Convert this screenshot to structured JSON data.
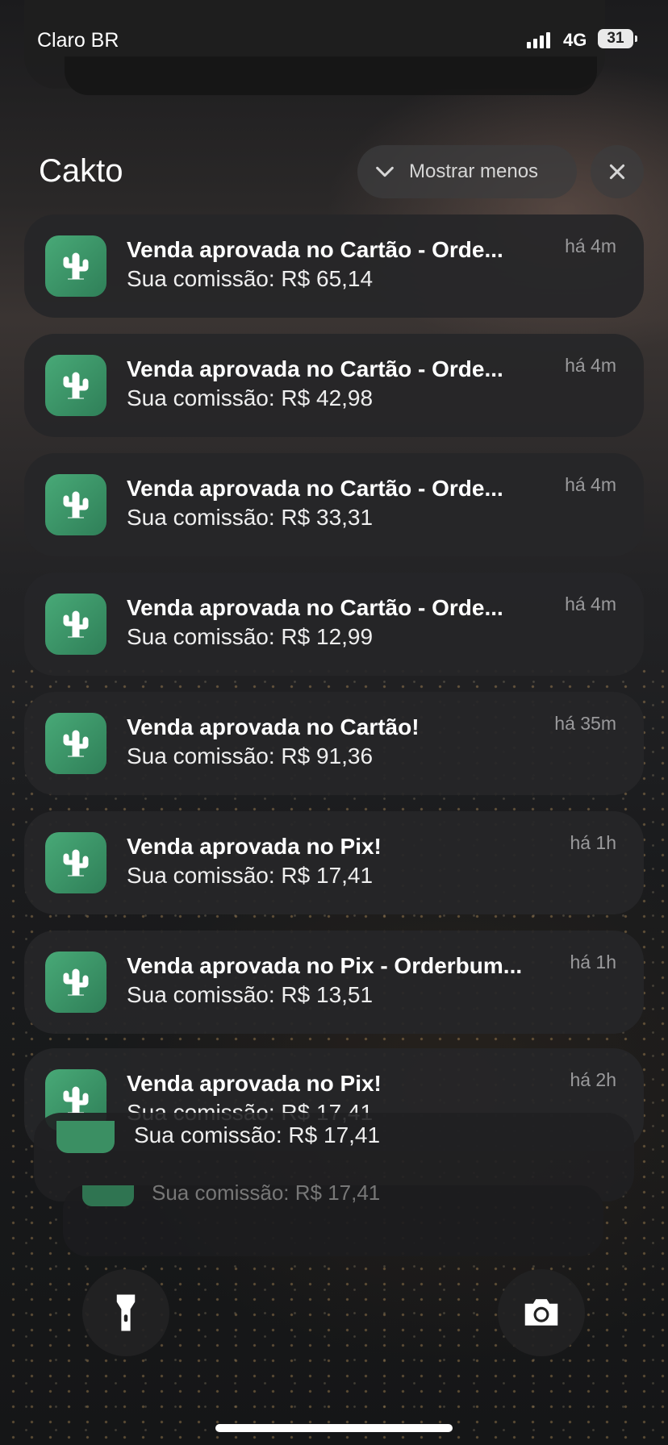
{
  "status_bar": {
    "carrier": "Claro BR",
    "network": "4G",
    "battery": "31"
  },
  "group": {
    "app_name": "Cakto",
    "show_less_label": "Mostrar menos"
  },
  "notifications": [
    {
      "title": "Venda aprovada no Cartão - Orde...",
      "body": "Sua comissão: R$ 65,14",
      "time": "há 4m"
    },
    {
      "title": "Venda aprovada no Cartão - Orde...",
      "body": "Sua comissão: R$ 42,98",
      "time": "há 4m"
    },
    {
      "title": "Venda aprovada no Cartão - Orde...",
      "body": "Sua comissão: R$ 33,31",
      "time": "há 4m"
    },
    {
      "title": "Venda aprovada no Cartão - Orde...",
      "body": "Sua comissão: R$ 12,99",
      "time": "há 4m"
    },
    {
      "title": "Venda aprovada no Cartão!",
      "body": "Sua comissão: R$ 91,36",
      "time": "há 35m"
    },
    {
      "title": "Venda aprovada no Pix!",
      "body": "Sua comissão: R$ 17,41",
      "time": "há 1h"
    },
    {
      "title": "Venda aprovada no Pix - Orderbum...",
      "body": "Sua comissão: R$ 13,51",
      "time": "há 1h"
    },
    {
      "title": "Venda aprovada no Pix!",
      "body": "Sua comissão: R$ 17,41",
      "time": "há 2h"
    }
  ],
  "stacked": [
    {
      "body": "Sua comissão: R$ 17,41"
    },
    {
      "body": "Sua comissão: R$ 17,41"
    }
  ],
  "icons": {
    "app": "cactus-icon",
    "chevron": "chevron-down-icon",
    "close": "close-icon",
    "flashlight": "flashlight-icon",
    "camera": "camera-icon"
  },
  "colors": {
    "app_icon": "#3f9a6b",
    "card": "#262628",
    "time": "#9a9a9c"
  }
}
